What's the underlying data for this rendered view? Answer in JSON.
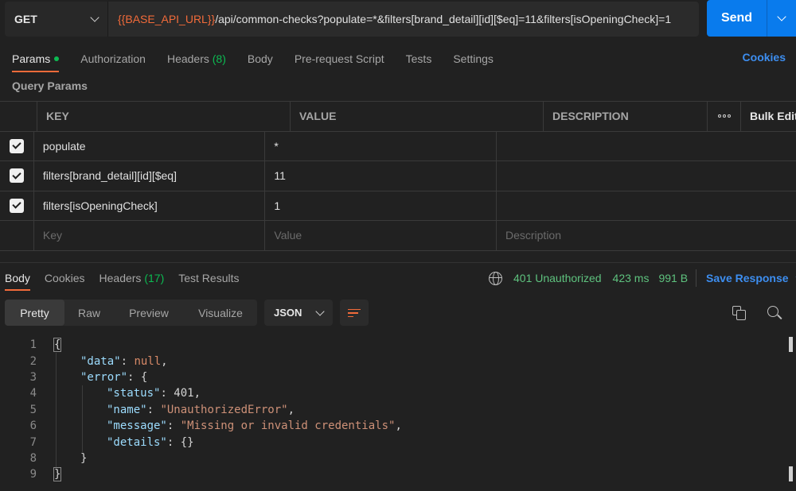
{
  "request": {
    "method": "GET",
    "url_variable": "{{BASE_API_URL}}",
    "url_rest": "/api/common-checks?populate=*&filters[brand_detail][id][$eq]=11&filters[isOpeningCheck]=1",
    "send_label": "Send"
  },
  "tabs": {
    "params": "Params",
    "authorization": "Authorization",
    "headers": "Headers",
    "headers_count": "(8)",
    "body": "Body",
    "prerequest": "Pre-request Script",
    "tests": "Tests",
    "settings": "Settings",
    "cookies": "Cookies"
  },
  "query_params": {
    "title": "Query Params",
    "headers": {
      "key": "KEY",
      "value": "VALUE",
      "description": "DESCRIPTION",
      "bulk_edit": "Bulk Edit"
    },
    "rows": [
      {
        "key": "populate",
        "value": "*",
        "description": ""
      },
      {
        "key": "filters[brand_detail][id][$eq]",
        "value": "11",
        "description": ""
      },
      {
        "key": "filters[isOpeningCheck]",
        "value": "1",
        "description": ""
      }
    ],
    "placeholders": {
      "key": "Key",
      "value": "Value",
      "description": "Description"
    }
  },
  "response": {
    "tabs": {
      "body": "Body",
      "cookies": "Cookies",
      "headers": "Headers",
      "headers_count": "(17)",
      "test_results": "Test Results"
    },
    "status": "401 Unauthorized",
    "time": "423 ms",
    "size": "991 B",
    "save_label": "Save Response",
    "view_modes": [
      "Pretty",
      "Raw",
      "Preview",
      "Visualize"
    ],
    "format": "JSON",
    "line_numbers": [
      "1",
      "2",
      "3",
      "4",
      "5",
      "6",
      "7",
      "8",
      "9"
    ],
    "json": {
      "data_key": "\"data\"",
      "data_val": "null",
      "error_key": "\"error\"",
      "status_key": "\"status\"",
      "status_val": "401",
      "name_key": "\"name\"",
      "name_val": "\"UnauthorizedError\"",
      "message_key": "\"message\"",
      "message_val": "\"Missing or invalid credentials\"",
      "details_key": "\"details\"",
      "details_val": "{}"
    }
  },
  "colors": {
    "accent": "#f26b3a",
    "send": "#097bed",
    "success": "#0cbb52",
    "link": "#3d8ef0"
  }
}
